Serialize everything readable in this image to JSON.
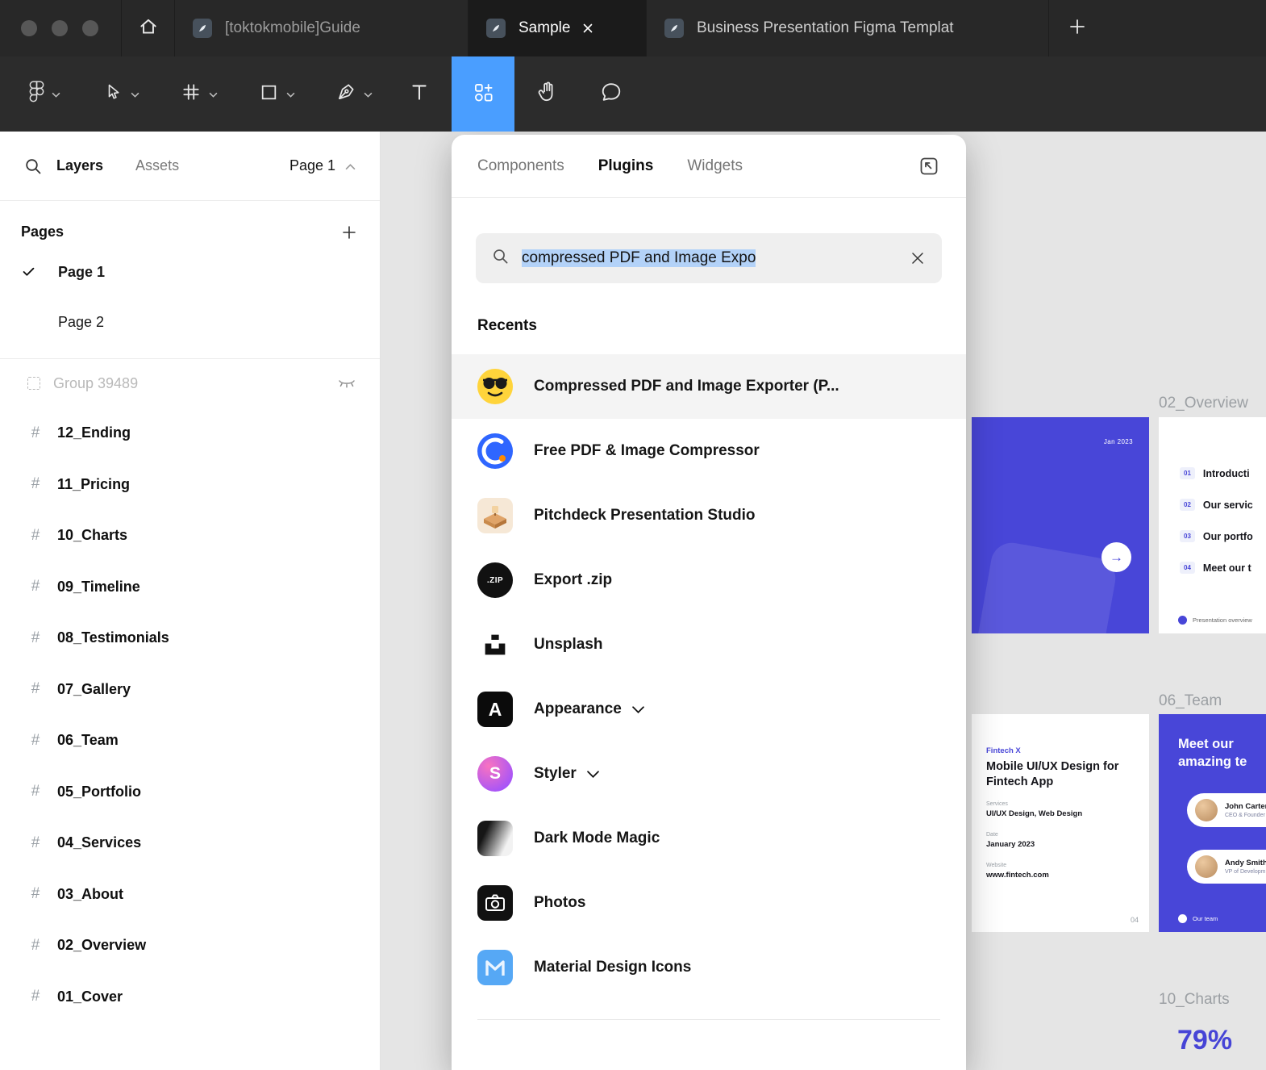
{
  "colors": {
    "accent_blue": "#4a9eff",
    "slide_blue": "#4846d8",
    "selection_highlight": "#b3d2f8"
  },
  "window": {
    "tabs": [
      {
        "label": "[toktokmobile]Guide",
        "active": false
      },
      {
        "label": "Sample",
        "active": true
      },
      {
        "label": "Business Presentation Figma Templat",
        "active": false
      }
    ]
  },
  "toolbar": {
    "tools": [
      "main-menu",
      "move-tool",
      "frame-tool",
      "shape-tool",
      "pen-tool",
      "text-tool",
      "resources-tool",
      "hand-tool",
      "comment-tool"
    ],
    "active_tool": "resources-tool"
  },
  "sidebar": {
    "tabs": {
      "layers": "Layers",
      "assets": "Assets"
    },
    "page_selector": "Page 1",
    "pages_header": "Pages",
    "pages": [
      {
        "label": "Page 1",
        "checked": true
      },
      {
        "label": "Page 2",
        "checked": false
      }
    ],
    "group": {
      "label": "Group 39489"
    },
    "frames": [
      "12_Ending",
      "11_Pricing",
      "10_Charts",
      "09_Timeline",
      "08_Testimonials",
      "07_Gallery",
      "06_Team",
      "05_Portfolio",
      "04_Services",
      "03_About",
      "02_Overview",
      "01_Cover"
    ]
  },
  "modal": {
    "tabs": [
      "Components",
      "Plugins",
      "Widgets"
    ],
    "active_tab": "Plugins",
    "search": {
      "value": "compressed PDF and Image Expo"
    },
    "recents_header": "Recents",
    "items": [
      {
        "label": "Compressed PDF and Image Exporter (P...",
        "icon": "emoji-sunglasses-icon",
        "selected": true
      },
      {
        "label": "Free PDF & Image Compressor",
        "icon": "compressor-icon"
      },
      {
        "label": "Pitchdeck Presentation Studio",
        "icon": "pitchdeck-icon"
      },
      {
        "label": "Export .zip",
        "icon": "zip-icon"
      },
      {
        "label": "Unsplash",
        "icon": "unsplash-icon"
      },
      {
        "label": "Appearance",
        "icon": "appearance-icon",
        "expandable": true
      },
      {
        "label": "Styler",
        "icon": "styler-icon",
        "expandable": true
      },
      {
        "label": "Dark Mode Magic",
        "icon": "dark-mode-icon"
      },
      {
        "label": "Photos",
        "icon": "photos-icon"
      },
      {
        "label": "Material Design Icons",
        "icon": "material-design-icon"
      }
    ],
    "zip_icon_text": ".ZIP",
    "appearance_icon_text": "A",
    "styler_icon_text": "S"
  },
  "canvas": {
    "labels": {
      "overview": "02_Overview",
      "team": "06_Team",
      "charts": "10_Charts"
    },
    "overview_slide": {
      "date": "Jan 2023",
      "arrow": "→"
    },
    "overview_list": {
      "items": [
        {
          "num": "01",
          "text": "Introducti"
        },
        {
          "num": "02",
          "text": "Our servic"
        },
        {
          "num": "03",
          "text": "Our portfo"
        },
        {
          "num": "04",
          "text": "Meet our t"
        }
      ],
      "footer": "Presentation overview"
    },
    "team_left": {
      "brand": "Fintech X",
      "title": "Mobile UI/UX Design for Fintech App",
      "services_label": "Services",
      "services": "UI/UX Design, Web Design",
      "date_label": "Date",
      "date": "January 2023",
      "website_label": "Website",
      "website": "www.fintech.com",
      "page_num": "04"
    },
    "team_right": {
      "title": "Meet our amazing te",
      "members": [
        {
          "name": "John Carter",
          "role": "CEO & Founder"
        },
        {
          "name": "Andy Smith",
          "role": "VP of Developm"
        }
      ],
      "footer": "Our team"
    },
    "charts": {
      "value": "79%"
    }
  }
}
